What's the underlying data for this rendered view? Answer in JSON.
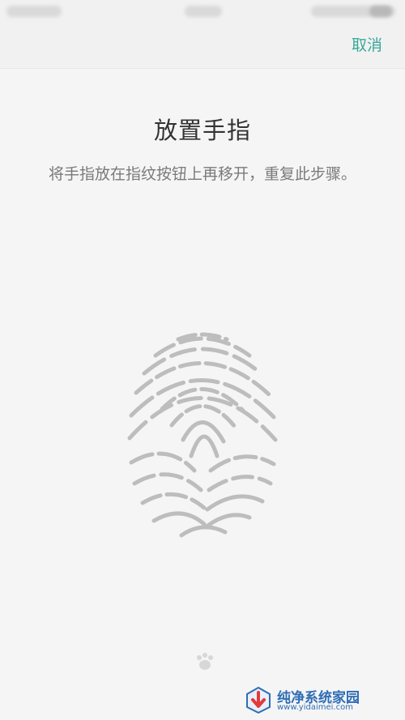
{
  "action_bar": {
    "cancel_label": "取消"
  },
  "main": {
    "title": "放置手指",
    "instruction": "将手指放在指纹按钮上再移开，重复此步骤。"
  },
  "watermark": {
    "title": "纯净系统家园",
    "url": "www.yidaimei.com"
  },
  "icons": {
    "fingerprint": "fingerprint-icon",
    "watermark_logo": "watermark-logo-icon"
  },
  "colors": {
    "accent": "#3aa89a",
    "background": "#f5f5f5",
    "fingerprint": "#bdbdbd"
  }
}
